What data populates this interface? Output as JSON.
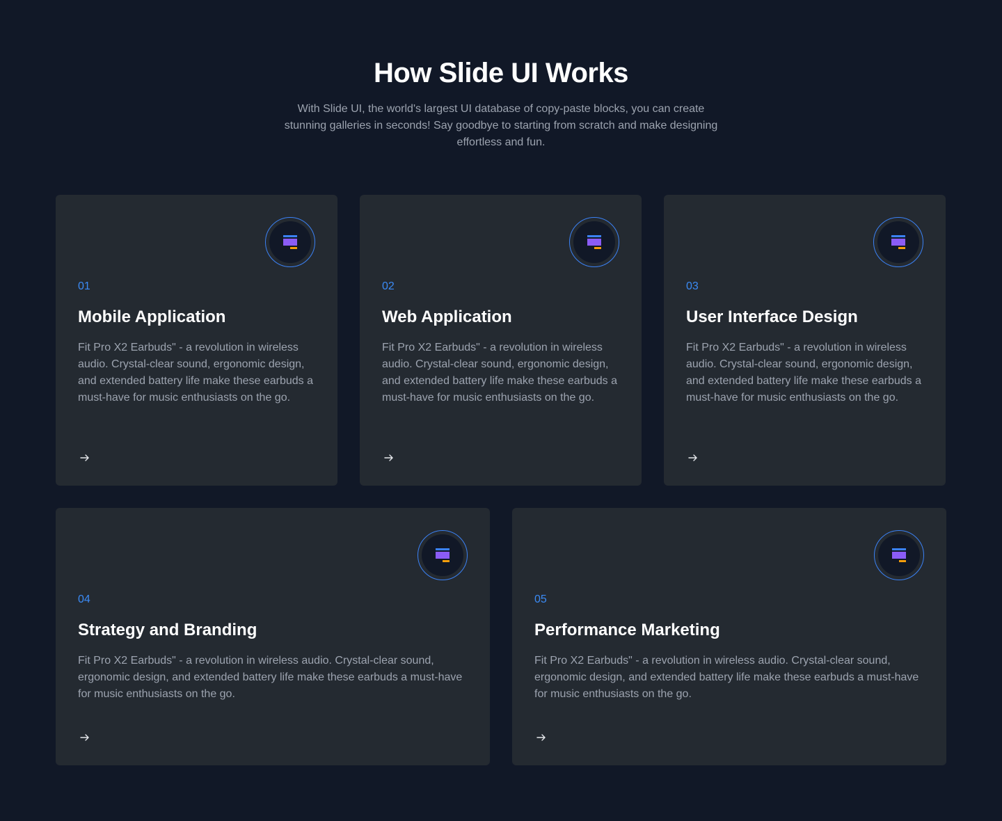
{
  "header": {
    "title": "How Slide UI Works",
    "subtitle": "With Slide UI, the world's largest UI database of copy-paste blocks, you can create stunning galleries in seconds! Say goodbye to starting from scratch and make designing effortless and fun."
  },
  "colors": {
    "background": "#111827",
    "card": "#242a31",
    "accent": "#3b82f6",
    "icon_purple": "#8b5cf6",
    "icon_blue": "#3b82f6",
    "icon_orange": "#f59e0b"
  },
  "cards": [
    {
      "number": "01",
      "title": "Mobile Application",
      "description": "Fit Pro X2 Earbuds\" - a revolution in wireless audio. Crystal-clear sound, ergonomic design, and extended battery life make these earbuds a must-have for music enthusiasts on the go.",
      "icon": "layers-icon",
      "arrow": "arrow-right-icon"
    },
    {
      "number": "02",
      "title": "Web Application",
      "description": "Fit Pro X2 Earbuds\" - a revolution in wireless audio. Crystal-clear sound, ergonomic design, and extended battery life make these earbuds a must-have for music enthusiasts on the go.",
      "icon": "layers-icon",
      "arrow": "arrow-right-icon"
    },
    {
      "number": "03",
      "title": "User Interface Design",
      "description": "Fit Pro X2 Earbuds\" - a revolution in wireless audio. Crystal-clear sound, ergonomic design, and extended battery life make these earbuds a must-have for music enthusiasts on the go.",
      "icon": "layers-icon",
      "arrow": "arrow-right-icon"
    },
    {
      "number": "04",
      "title": "Strategy and Branding",
      "description": "Fit Pro X2 Earbuds\" - a revolution in wireless audio. Crystal-clear sound, ergonomic design, and extended battery life make these earbuds a must-have for music enthusiasts on the go.",
      "icon": "layers-icon",
      "arrow": "arrow-right-icon"
    },
    {
      "number": "05",
      "title": "Performance Marketing",
      "description": "Fit Pro X2 Earbuds\" - a revolution in wireless audio. Crystal-clear sound, ergonomic design, and extended battery life make these earbuds a must-have for music enthusiasts on the go.",
      "icon": "layers-icon",
      "arrow": "arrow-right-icon"
    }
  ]
}
